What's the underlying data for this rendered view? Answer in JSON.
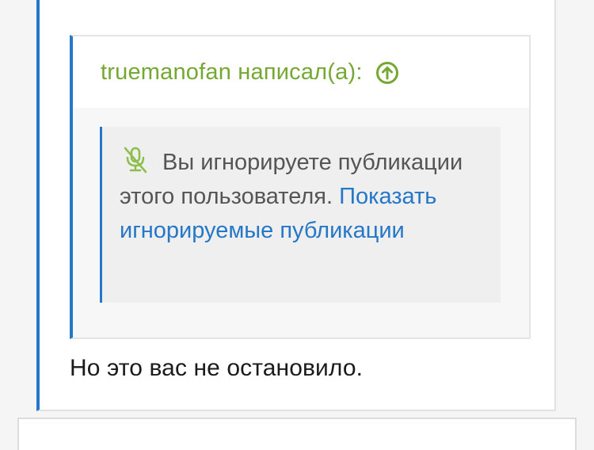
{
  "quote": {
    "author_line": "truemanofan написал(а):",
    "up_icon": "arrow-circle-up-icon",
    "author_color": "#75a832"
  },
  "ignored": {
    "mute_icon": "microphone-slash-icon",
    "message": "Вы игнорируете публикации этого пользователя.",
    "show_link": "Показать игнорируемые публикации",
    "link_color": "#2577c8"
  },
  "post": {
    "body": "Но это вас не остановило.",
    "accent_color": "#2577c8"
  }
}
